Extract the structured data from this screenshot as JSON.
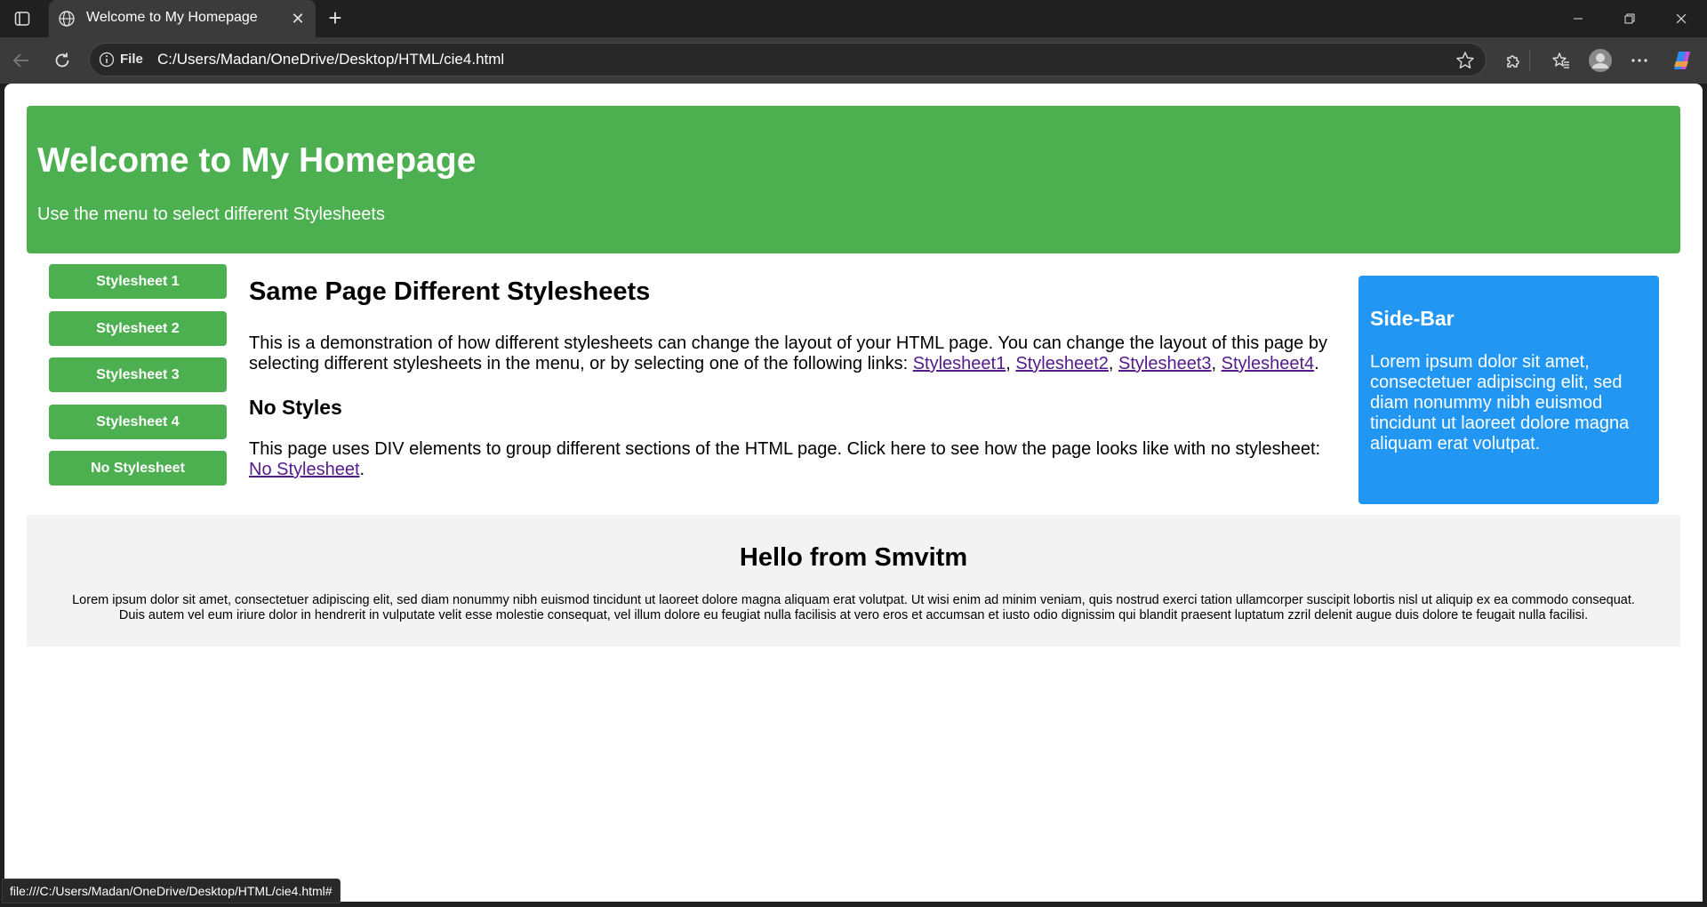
{
  "browser": {
    "tab_title": "Welcome to My Homepage",
    "scheme_label": "File",
    "url": "C:/Users/Madan/OneDrive/Desktop/HTML/cie4.html",
    "status_url": "file:///C:/Users/Madan/OneDrive/Desktop/HTML/cie4.html#"
  },
  "header": {
    "title": "Welcome to My Homepage",
    "subtitle": "Use the menu to select different Stylesheets"
  },
  "menu": {
    "items": [
      "Stylesheet 1",
      "Stylesheet 2",
      "Stylesheet 3",
      "Stylesheet 4",
      "No Stylesheet"
    ]
  },
  "main": {
    "heading": "Same Page Different Stylesheets",
    "para1_text": "This is a demonstration of how different stylesheets can change the layout of your HTML page. You can change the layout of this page by selecting different stylesheets in the menu, or by selecting one of the following links: ",
    "para1_links": [
      "Stylesheet1",
      "Stylesheet2",
      "Stylesheet3",
      "Stylesheet4"
    ],
    "subheading": "No Styles",
    "para2_text": "This page uses DIV elements to group different sections of the HTML page. Click here to see how the page looks like with no stylesheet: ",
    "para2_link": "No Stylesheet"
  },
  "sidebar": {
    "title": "Side-Bar",
    "text": "Lorem ipsum dolor sit amet, consectetuer adipiscing elit, sed diam nonummy nibh euismod tincidunt ut laoreet dolore magna aliquam erat volutpat."
  },
  "footer": {
    "title": "Hello from Smvitm",
    "text": "Lorem ipsum dolor sit amet, consectetuer adipiscing elit, sed diam nonummy nibh euismod tincidunt ut laoreet dolore magna aliquam erat volutpat. Ut wisi enim ad minim veniam, quis nostrud exerci tation ullamcorper suscipit lobortis nisl ut aliquip ex ea commodo consequat. Duis autem vel eum iriure dolor in hendrerit in vulputate velit esse molestie consequat, vel illum dolore eu feugiat nulla facilisis at vero eros et accumsan et iusto odio dignissim qui blandit praesent luptatum zzril delenit augue duis dolore te feugait nulla facilisi."
  },
  "colors": {
    "header_bg": "#4caf50",
    "sidebar_bg": "#2196f3",
    "footer_bg": "#f3f3f3",
    "visited_link": "#551a8b"
  },
  "icons": [
    "tab-actions-icon",
    "globe-icon",
    "close-icon",
    "plus-icon",
    "minimize-icon",
    "restore-icon",
    "window-close-icon",
    "back-icon",
    "refresh-icon",
    "info-icon",
    "star-icon",
    "extensions-icon",
    "favorites-icon",
    "profile-icon",
    "more-icon",
    "copilot-icon"
  ]
}
